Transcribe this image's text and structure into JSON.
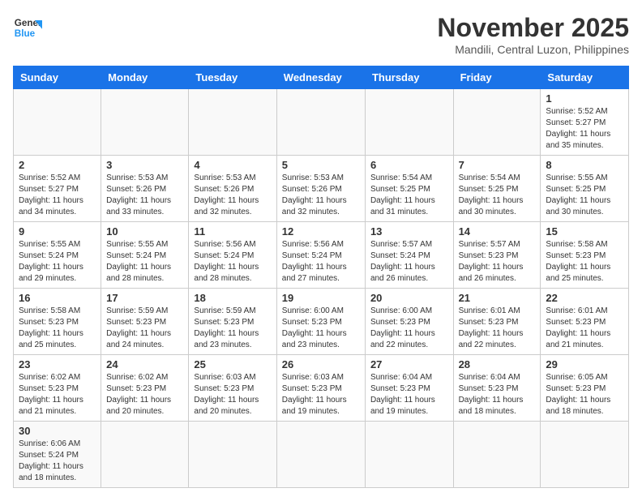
{
  "logo": {
    "text_general": "General",
    "text_blue": "Blue"
  },
  "title": {
    "month": "November 2025",
    "location": "Mandili, Central Luzon, Philippines"
  },
  "weekdays": [
    "Sunday",
    "Monday",
    "Tuesday",
    "Wednesday",
    "Thursday",
    "Friday",
    "Saturday"
  ],
  "weeks": [
    [
      {
        "day": "",
        "info": ""
      },
      {
        "day": "",
        "info": ""
      },
      {
        "day": "",
        "info": ""
      },
      {
        "day": "",
        "info": ""
      },
      {
        "day": "",
        "info": ""
      },
      {
        "day": "",
        "info": ""
      },
      {
        "day": "1",
        "info": "Sunrise: 5:52 AM\nSunset: 5:27 PM\nDaylight: 11 hours\nand 35 minutes."
      }
    ],
    [
      {
        "day": "2",
        "info": "Sunrise: 5:52 AM\nSunset: 5:27 PM\nDaylight: 11 hours\nand 34 minutes."
      },
      {
        "day": "3",
        "info": "Sunrise: 5:53 AM\nSunset: 5:26 PM\nDaylight: 11 hours\nand 33 minutes."
      },
      {
        "day": "4",
        "info": "Sunrise: 5:53 AM\nSunset: 5:26 PM\nDaylight: 11 hours\nand 32 minutes."
      },
      {
        "day": "5",
        "info": "Sunrise: 5:53 AM\nSunset: 5:26 PM\nDaylight: 11 hours\nand 32 minutes."
      },
      {
        "day": "6",
        "info": "Sunrise: 5:54 AM\nSunset: 5:25 PM\nDaylight: 11 hours\nand 31 minutes."
      },
      {
        "day": "7",
        "info": "Sunrise: 5:54 AM\nSunset: 5:25 PM\nDaylight: 11 hours\nand 30 minutes."
      },
      {
        "day": "8",
        "info": "Sunrise: 5:55 AM\nSunset: 5:25 PM\nDaylight: 11 hours\nand 30 minutes."
      }
    ],
    [
      {
        "day": "9",
        "info": "Sunrise: 5:55 AM\nSunset: 5:24 PM\nDaylight: 11 hours\nand 29 minutes."
      },
      {
        "day": "10",
        "info": "Sunrise: 5:55 AM\nSunset: 5:24 PM\nDaylight: 11 hours\nand 28 minutes."
      },
      {
        "day": "11",
        "info": "Sunrise: 5:56 AM\nSunset: 5:24 PM\nDaylight: 11 hours\nand 28 minutes."
      },
      {
        "day": "12",
        "info": "Sunrise: 5:56 AM\nSunset: 5:24 PM\nDaylight: 11 hours\nand 27 minutes."
      },
      {
        "day": "13",
        "info": "Sunrise: 5:57 AM\nSunset: 5:24 PM\nDaylight: 11 hours\nand 26 minutes."
      },
      {
        "day": "14",
        "info": "Sunrise: 5:57 AM\nSunset: 5:23 PM\nDaylight: 11 hours\nand 26 minutes."
      },
      {
        "day": "15",
        "info": "Sunrise: 5:58 AM\nSunset: 5:23 PM\nDaylight: 11 hours\nand 25 minutes."
      }
    ],
    [
      {
        "day": "16",
        "info": "Sunrise: 5:58 AM\nSunset: 5:23 PM\nDaylight: 11 hours\nand 25 minutes."
      },
      {
        "day": "17",
        "info": "Sunrise: 5:59 AM\nSunset: 5:23 PM\nDaylight: 11 hours\nand 24 minutes."
      },
      {
        "day": "18",
        "info": "Sunrise: 5:59 AM\nSunset: 5:23 PM\nDaylight: 11 hours\nand 23 minutes."
      },
      {
        "day": "19",
        "info": "Sunrise: 6:00 AM\nSunset: 5:23 PM\nDaylight: 11 hours\nand 23 minutes."
      },
      {
        "day": "20",
        "info": "Sunrise: 6:00 AM\nSunset: 5:23 PM\nDaylight: 11 hours\nand 22 minutes."
      },
      {
        "day": "21",
        "info": "Sunrise: 6:01 AM\nSunset: 5:23 PM\nDaylight: 11 hours\nand 22 minutes."
      },
      {
        "day": "22",
        "info": "Sunrise: 6:01 AM\nSunset: 5:23 PM\nDaylight: 11 hours\nand 21 minutes."
      }
    ],
    [
      {
        "day": "23",
        "info": "Sunrise: 6:02 AM\nSunset: 5:23 PM\nDaylight: 11 hours\nand 21 minutes."
      },
      {
        "day": "24",
        "info": "Sunrise: 6:02 AM\nSunset: 5:23 PM\nDaylight: 11 hours\nand 20 minutes."
      },
      {
        "day": "25",
        "info": "Sunrise: 6:03 AM\nSunset: 5:23 PM\nDaylight: 11 hours\nand 20 minutes."
      },
      {
        "day": "26",
        "info": "Sunrise: 6:03 AM\nSunset: 5:23 PM\nDaylight: 11 hours\nand 19 minutes."
      },
      {
        "day": "27",
        "info": "Sunrise: 6:04 AM\nSunset: 5:23 PM\nDaylight: 11 hours\nand 19 minutes."
      },
      {
        "day": "28",
        "info": "Sunrise: 6:04 AM\nSunset: 5:23 PM\nDaylight: 11 hours\nand 18 minutes."
      },
      {
        "day": "29",
        "info": "Sunrise: 6:05 AM\nSunset: 5:23 PM\nDaylight: 11 hours\nand 18 minutes."
      }
    ],
    [
      {
        "day": "30",
        "info": "Sunrise: 6:06 AM\nSunset: 5:24 PM\nDaylight: 11 hours\nand 18 minutes."
      },
      {
        "day": "",
        "info": ""
      },
      {
        "day": "",
        "info": ""
      },
      {
        "day": "",
        "info": ""
      },
      {
        "day": "",
        "info": ""
      },
      {
        "day": "",
        "info": ""
      },
      {
        "day": "",
        "info": ""
      }
    ]
  ]
}
